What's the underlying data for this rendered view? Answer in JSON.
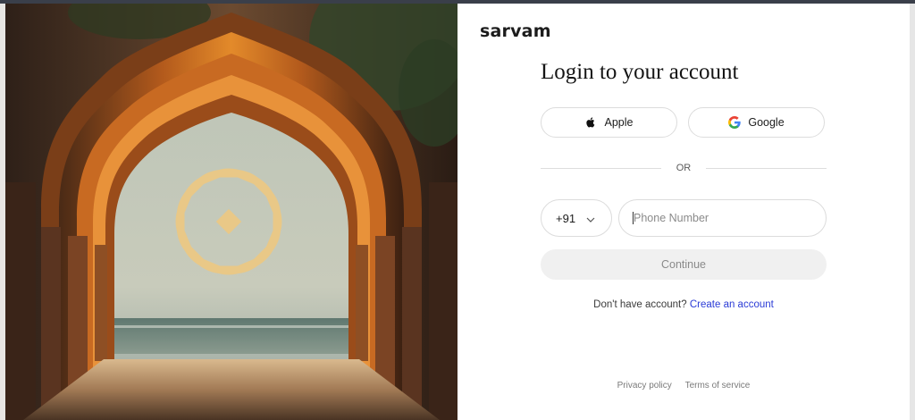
{
  "brand": {
    "name": "sarvam"
  },
  "login": {
    "title": "Login to your account",
    "apple_label": "Apple",
    "google_label": "Google",
    "or_text": "OR",
    "country_code": "+91",
    "phone_placeholder": "Phone Number",
    "phone_value": "",
    "continue_label": "Continue",
    "signup_prompt": "Don't have account?",
    "signup_link": "Create an account"
  },
  "footer": {
    "privacy": "Privacy policy",
    "terms": "Terms of service"
  },
  "icons": {
    "apple": "apple-icon",
    "google": "google-icon",
    "dropdown": "chevron-down-icon"
  },
  "colors": {
    "link": "#2a3bd6",
    "border": "#dcdcdc",
    "continue_bg": "#f0f0f0",
    "continue_text": "#8a8a8a",
    "logo_gold": "#e9c887"
  }
}
